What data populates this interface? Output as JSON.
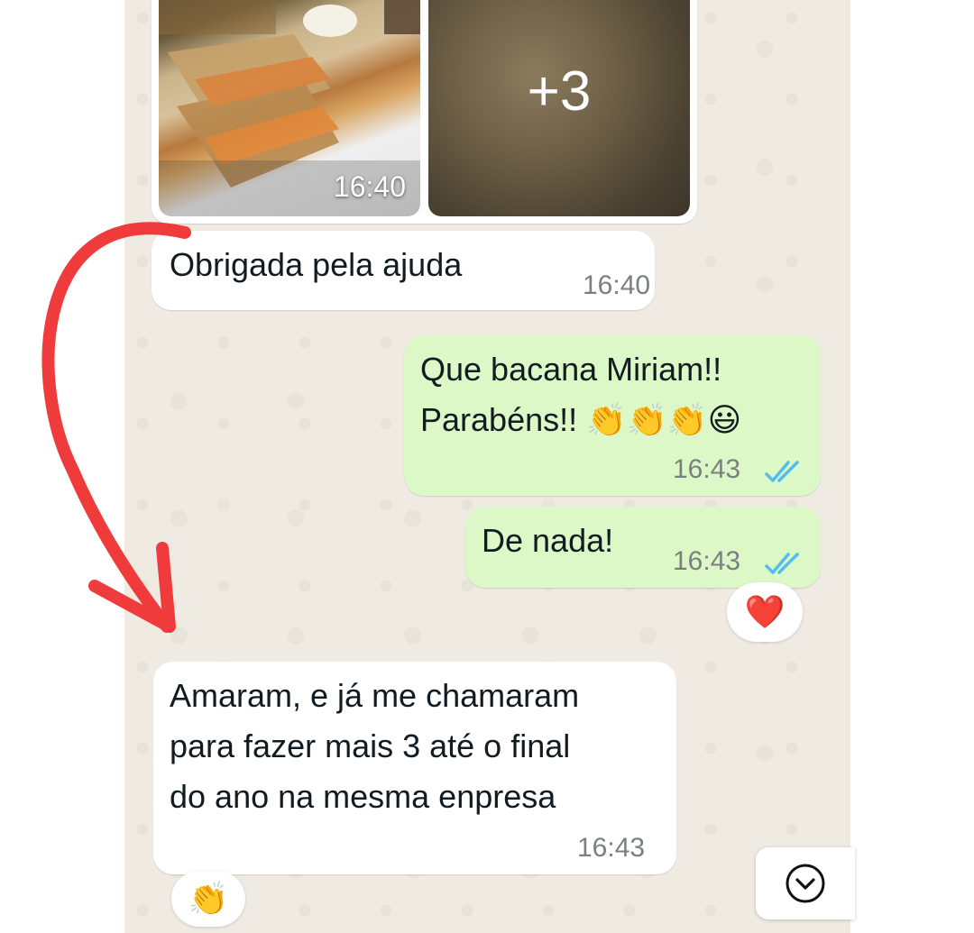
{
  "messages": {
    "photo_album": {
      "time": "16:40",
      "more_count": "+3"
    },
    "thanks": {
      "text": "Obrigada pela ajuda",
      "time": "16:40"
    },
    "congrats": {
      "text": "Que bacana Miriam!!\nParabéns!! 👏👏👏😃",
      "time": "16:43"
    },
    "welcome": {
      "text": "De nada!",
      "time": "16:43",
      "reaction": "❤️"
    },
    "loved": {
      "text": "Amaram, e já me chamaram\npara fazer mais 3 até o final\ndo ano na mesma enpresa",
      "time": "16:43",
      "reaction": "👏"
    }
  },
  "icons": {
    "read_receipt": "double-check-icon",
    "scroll_down": "chevron-down-circle-icon"
  },
  "colors": {
    "chat_background": "#efeae2",
    "incoming_bubble": "#ffffff",
    "outgoing_bubble": "#dcf8c6",
    "read_ticks": "#53bdeb",
    "annotation_arrow": "#ef3b3b"
  }
}
